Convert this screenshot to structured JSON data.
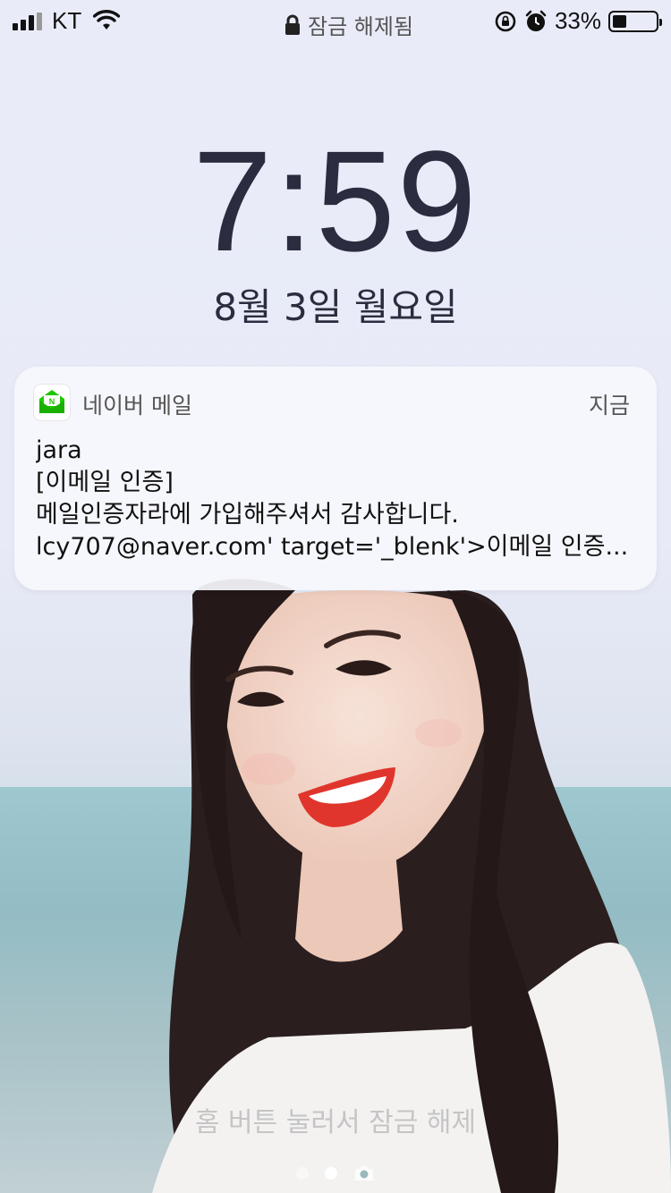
{
  "status_bar": {
    "carrier": "KT",
    "lock_status": "잠금 해제됨",
    "battery_percent": "33%",
    "battery_level": 0.33
  },
  "lockscreen": {
    "time": "7:59",
    "date": "8월 3일 월요일",
    "hint": "홈 버튼 눌러서 잠금 해제",
    "page_count": 2,
    "active_page": 1
  },
  "notification": {
    "app_name": "네이버 메일",
    "time": "지금",
    "sender": "jara",
    "subject": "[이메일 인증]",
    "body_line1": "메일인증자라에 가입해주셔서 감사합니다.",
    "body_line2": "lcy707@naver.com' target='_blenk'>이메일 인증..."
  },
  "colors": {
    "text_dark": "#2c2c40",
    "app_icon_green": "#1ec800"
  },
  "icons": {
    "signal": "cellular-signal-icon",
    "wifi": "wifi-icon",
    "lock": "lock-icon",
    "rotation_lock": "rotation-lock-icon",
    "alarm": "alarm-icon",
    "battery": "battery-icon",
    "camera": "camera-icon",
    "app": "naver-mail-icon"
  }
}
